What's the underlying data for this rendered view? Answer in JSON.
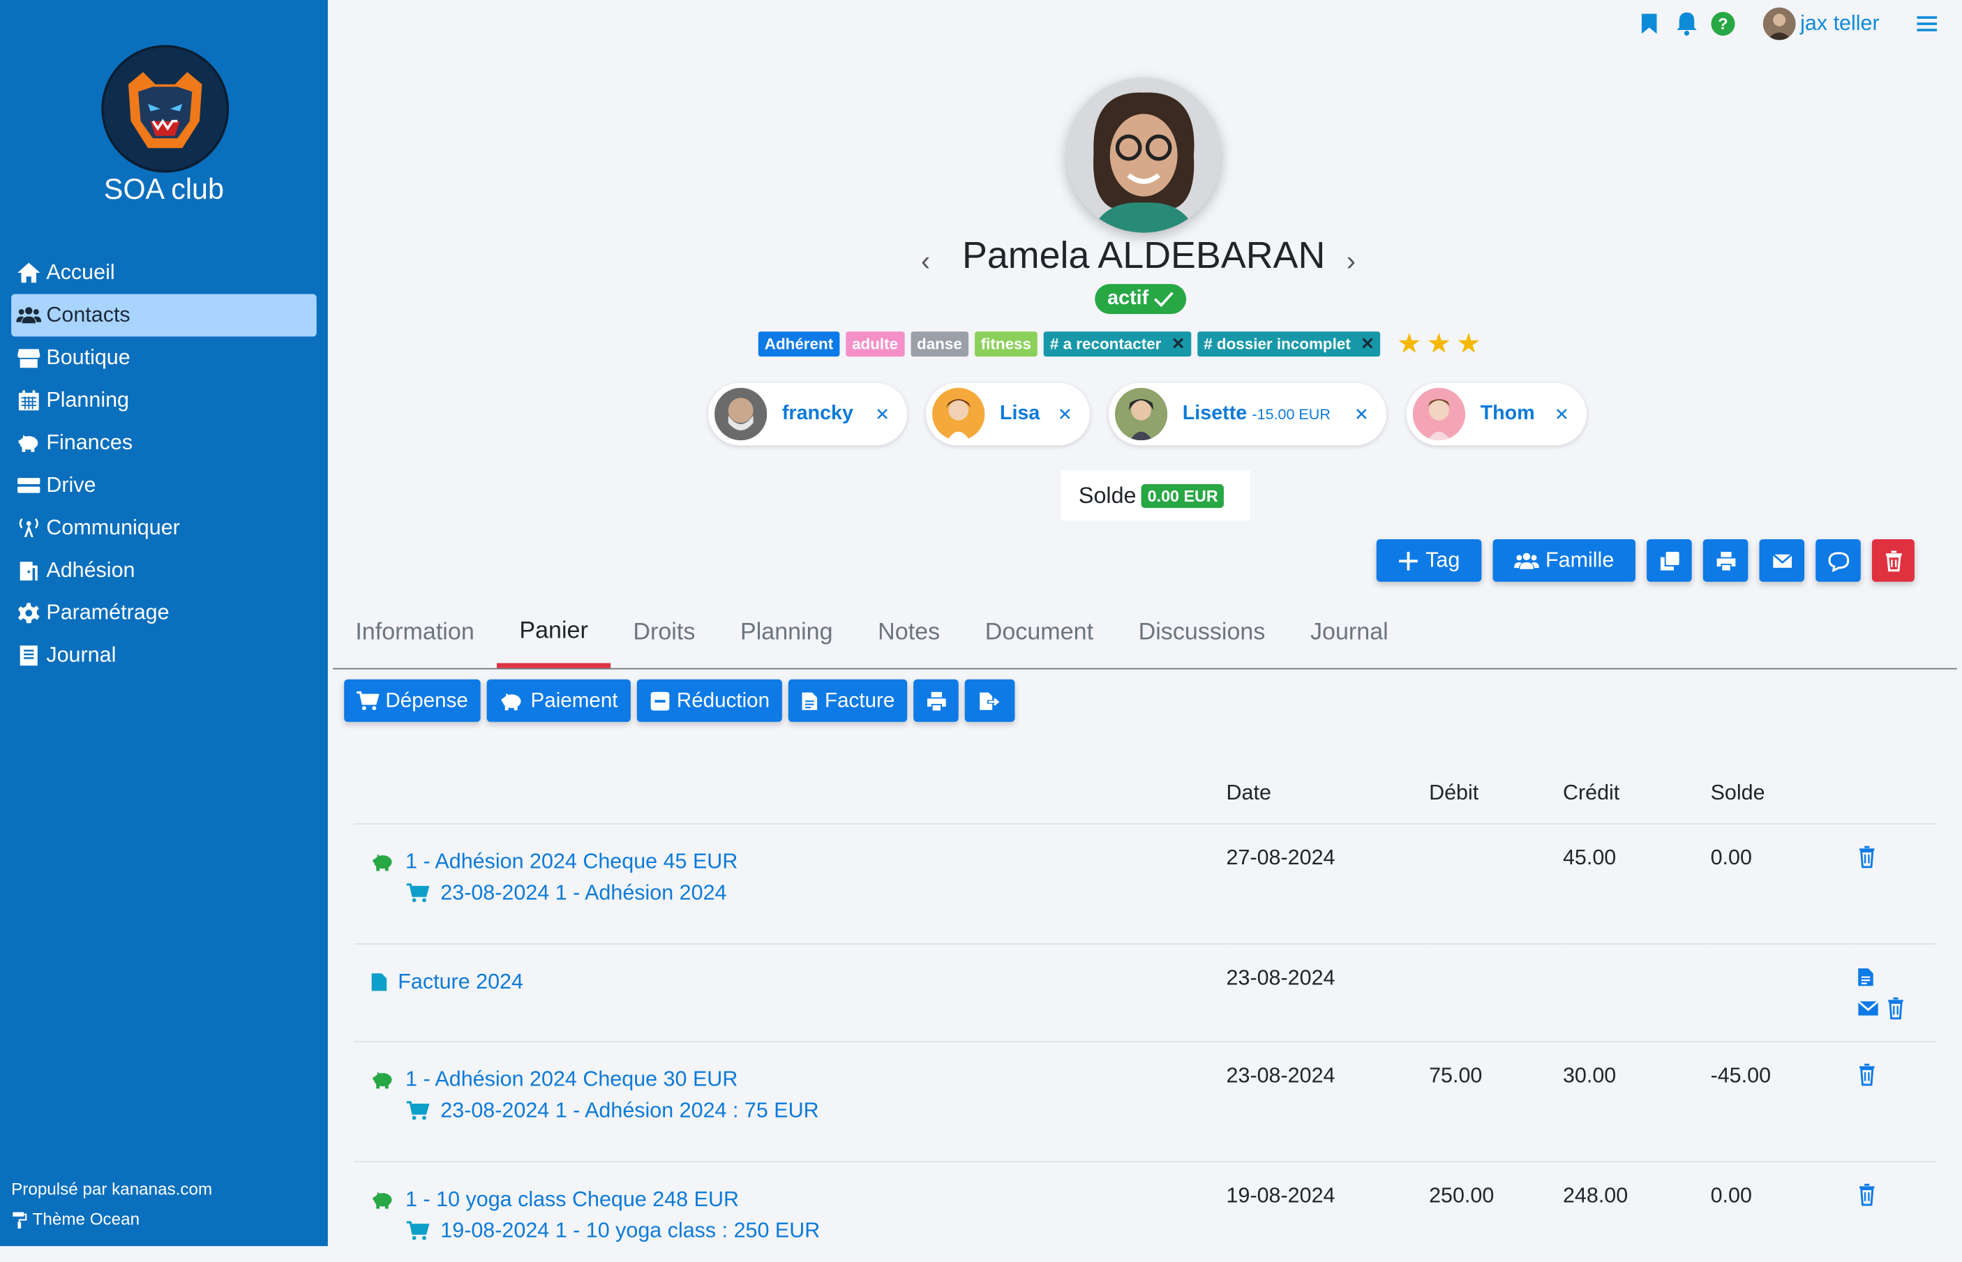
{
  "club": {
    "name": "SOA club"
  },
  "nav": [
    {
      "label": "Accueil",
      "icon": "home-icon"
    },
    {
      "label": "Contacts",
      "icon": "users-icon",
      "active": true
    },
    {
      "label": "Boutique",
      "icon": "store-icon"
    },
    {
      "label": "Planning",
      "icon": "calendar-icon"
    },
    {
      "label": "Finances",
      "icon": "piggy-bank-icon"
    },
    {
      "label": "Drive",
      "icon": "drive-icon"
    },
    {
      "label": "Communiquer",
      "icon": "broadcast-icon"
    },
    {
      "label": "Adhésion",
      "icon": "door-icon"
    },
    {
      "label": "Paramétrage",
      "icon": "gear-icon"
    },
    {
      "label": "Journal",
      "icon": "journal-icon"
    }
  ],
  "footer": {
    "powered": "Propulsé par kananas.com",
    "theme": "Thème Ocean"
  },
  "topbar": {
    "user": "jax teller"
  },
  "contact": {
    "name": "Pamela ALDEBARAN",
    "status": "actif",
    "stars": 3,
    "tags": [
      {
        "label": "Adhérent",
        "color": "#0d7ae6",
        "removable": false
      },
      {
        "label": "adulte",
        "color": "#f48fc8",
        "removable": false
      },
      {
        "label": "danse",
        "color": "#9aa0a6",
        "removable": false
      },
      {
        "label": "fitness",
        "color": "#8bd05a",
        "removable": false
      },
      {
        "label": "# a recontacter",
        "color": "#1798a8",
        "removable": true
      },
      {
        "label": "# dossier incomplet",
        "color": "#1798a8",
        "removable": true
      }
    ],
    "family": [
      {
        "name": "francky",
        "amount": ""
      },
      {
        "name": "Lisa",
        "amount": ""
      },
      {
        "name": "Lisette",
        "amount": "-15.00 EUR"
      },
      {
        "name": "Thom",
        "amount": ""
      }
    ],
    "solde_label": "Solde",
    "solde_value": "0.00 EUR"
  },
  "actions": {
    "tag": "Tag",
    "famille": "Famille"
  },
  "tabs": [
    "Information",
    "Panier",
    "Droits",
    "Planning",
    "Notes",
    "Document",
    "Discussions",
    "Journal"
  ],
  "active_tab": "Panier",
  "subactions": {
    "depense": "Dépense",
    "paiement": "Paiement",
    "reduction": "Réduction",
    "facture": "Facture"
  },
  "ledger": {
    "headers": {
      "date": "Date",
      "debit": "Débit",
      "credit": "Crédit",
      "solde": "Solde"
    },
    "rows": [
      {
        "type": "payment",
        "line1": "1 - Adhésion 2024 Cheque 45 EUR",
        "line2": "23-08-2024 1 - Adhésion 2024",
        "date": "27-08-2024",
        "debit": "",
        "credit": "45.00",
        "solde": "0.00"
      },
      {
        "type": "invoice",
        "line1": "Facture 2024",
        "line2": "",
        "date": "23-08-2024",
        "debit": "",
        "credit": "",
        "solde": ""
      },
      {
        "type": "payment",
        "line1": "1 - Adhésion 2024 Cheque 30 EUR",
        "line2": "23-08-2024 1 - Adhésion 2024 : 75 EUR",
        "date": "23-08-2024",
        "debit": "75.00",
        "credit": "30.00",
        "solde": "-45.00"
      },
      {
        "type": "payment",
        "line1": "1 - 10 yoga class Cheque 248 EUR",
        "line2": "19-08-2024 1 - 10 yoga class : 250 EUR",
        "date": "19-08-2024",
        "debit": "250.00",
        "credit": "248.00",
        "solde": "0.00"
      }
    ]
  }
}
